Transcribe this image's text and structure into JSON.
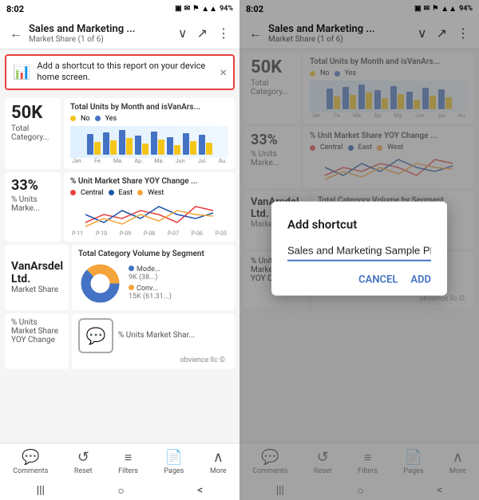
{
  "left": {
    "statusBar": {
      "time": "8:02",
      "icons": "▣ ✉ ⚑  ⓔ ▶ ⊠ ☁ 94%"
    },
    "nav": {
      "title": "Sales and Marketing ...",
      "subtitle": "Market Share (1 of 6)",
      "backIcon": "←",
      "dropdownIcon": "∨",
      "expandIcon": "↗",
      "moreIcon": "⋮"
    },
    "notification": {
      "text": "Add a shortcut to this report on your device home screen.",
      "closeIcon": "×"
    },
    "tiles": {
      "bigNumber": "50K",
      "bigLabel": "Total Category...",
      "chartTitle": "Total Units by Month and isVanArs...",
      "legend1Color": "#f4c518",
      "legend1Label": "No",
      "legend2Color": "#4472c4",
      "legend2Label": "Yes",
      "chartMonths": [
        "Jan.",
        "Fe.",
        "Ma.",
        "Ap.",
        "Ma.",
        "Jun.",
        "Jul.",
        "Au."
      ],
      "pctNumber": "33%",
      "pctLabel": "% Units Marke...",
      "pctTitle": "% Unit Market Share YOY Change ...",
      "legend3Color": "#e84040",
      "legend3Label": "Central",
      "legend4Color": "#2255aa",
      "legend4Label": "East",
      "legend5Color": "#f4a43a",
      "legend5Label": "West",
      "chartPeriods": [
        "P-11",
        "P-10",
        "P-09",
        "P-08",
        "P-07",
        "P-06",
        "P-05"
      ],
      "companyName": "VanArsdel Ltd.",
      "companyDesc": "Market Share",
      "donutTitle": "Total Category Volume by Segment",
      "donut1Label": "Mode...",
      "donut2Label": "Conv...",
      "donut1Val": "9K (38...)",
      "donut2Val": "15K (61.31...)",
      "pctLabel2": "% Units Market Share YOY Change",
      "obvience": "obvience llc ©",
      "bottomTile": "% Units Market Shar..."
    },
    "footer": {
      "items": [
        {
          "icon": "💬",
          "label": "Comments"
        },
        {
          "icon": "↺",
          "label": "Reset"
        },
        {
          "icon": "☰",
          "label": "Filters"
        },
        {
          "icon": "📄",
          "label": "Pages"
        },
        {
          "icon": "∧",
          "label": "More"
        }
      ]
    },
    "androidNav": [
      "|||",
      "○",
      "<"
    ]
  },
  "right": {
    "statusBar": {
      "time": "8:02",
      "icons": "▣ ✉ ⚑  ⓔ ▶ ⊠ ☁ 94%"
    },
    "nav": {
      "title": "Sales and Marketing ...",
      "subtitle": "Market Share (1 of 6)",
      "backIcon": "←",
      "dropdownIcon": "∨",
      "expandIcon": "↗",
      "moreIcon": "⋮"
    },
    "dialog": {
      "title": "Add shortcut",
      "inputValue": "Sales and Marketing Sample PBIX",
      "cancelLabel": "CANCEL",
      "addLabel": "ADD"
    },
    "footer": {
      "items": [
        {
          "icon": "💬",
          "label": "Comments"
        },
        {
          "icon": "↺",
          "label": "Reset"
        },
        {
          "icon": "☰",
          "label": "Filters"
        },
        {
          "icon": "📄",
          "label": "Pages"
        },
        {
          "icon": "∧",
          "label": "More"
        }
      ]
    },
    "androidNav": [
      "|||",
      "○",
      "<"
    ]
  }
}
